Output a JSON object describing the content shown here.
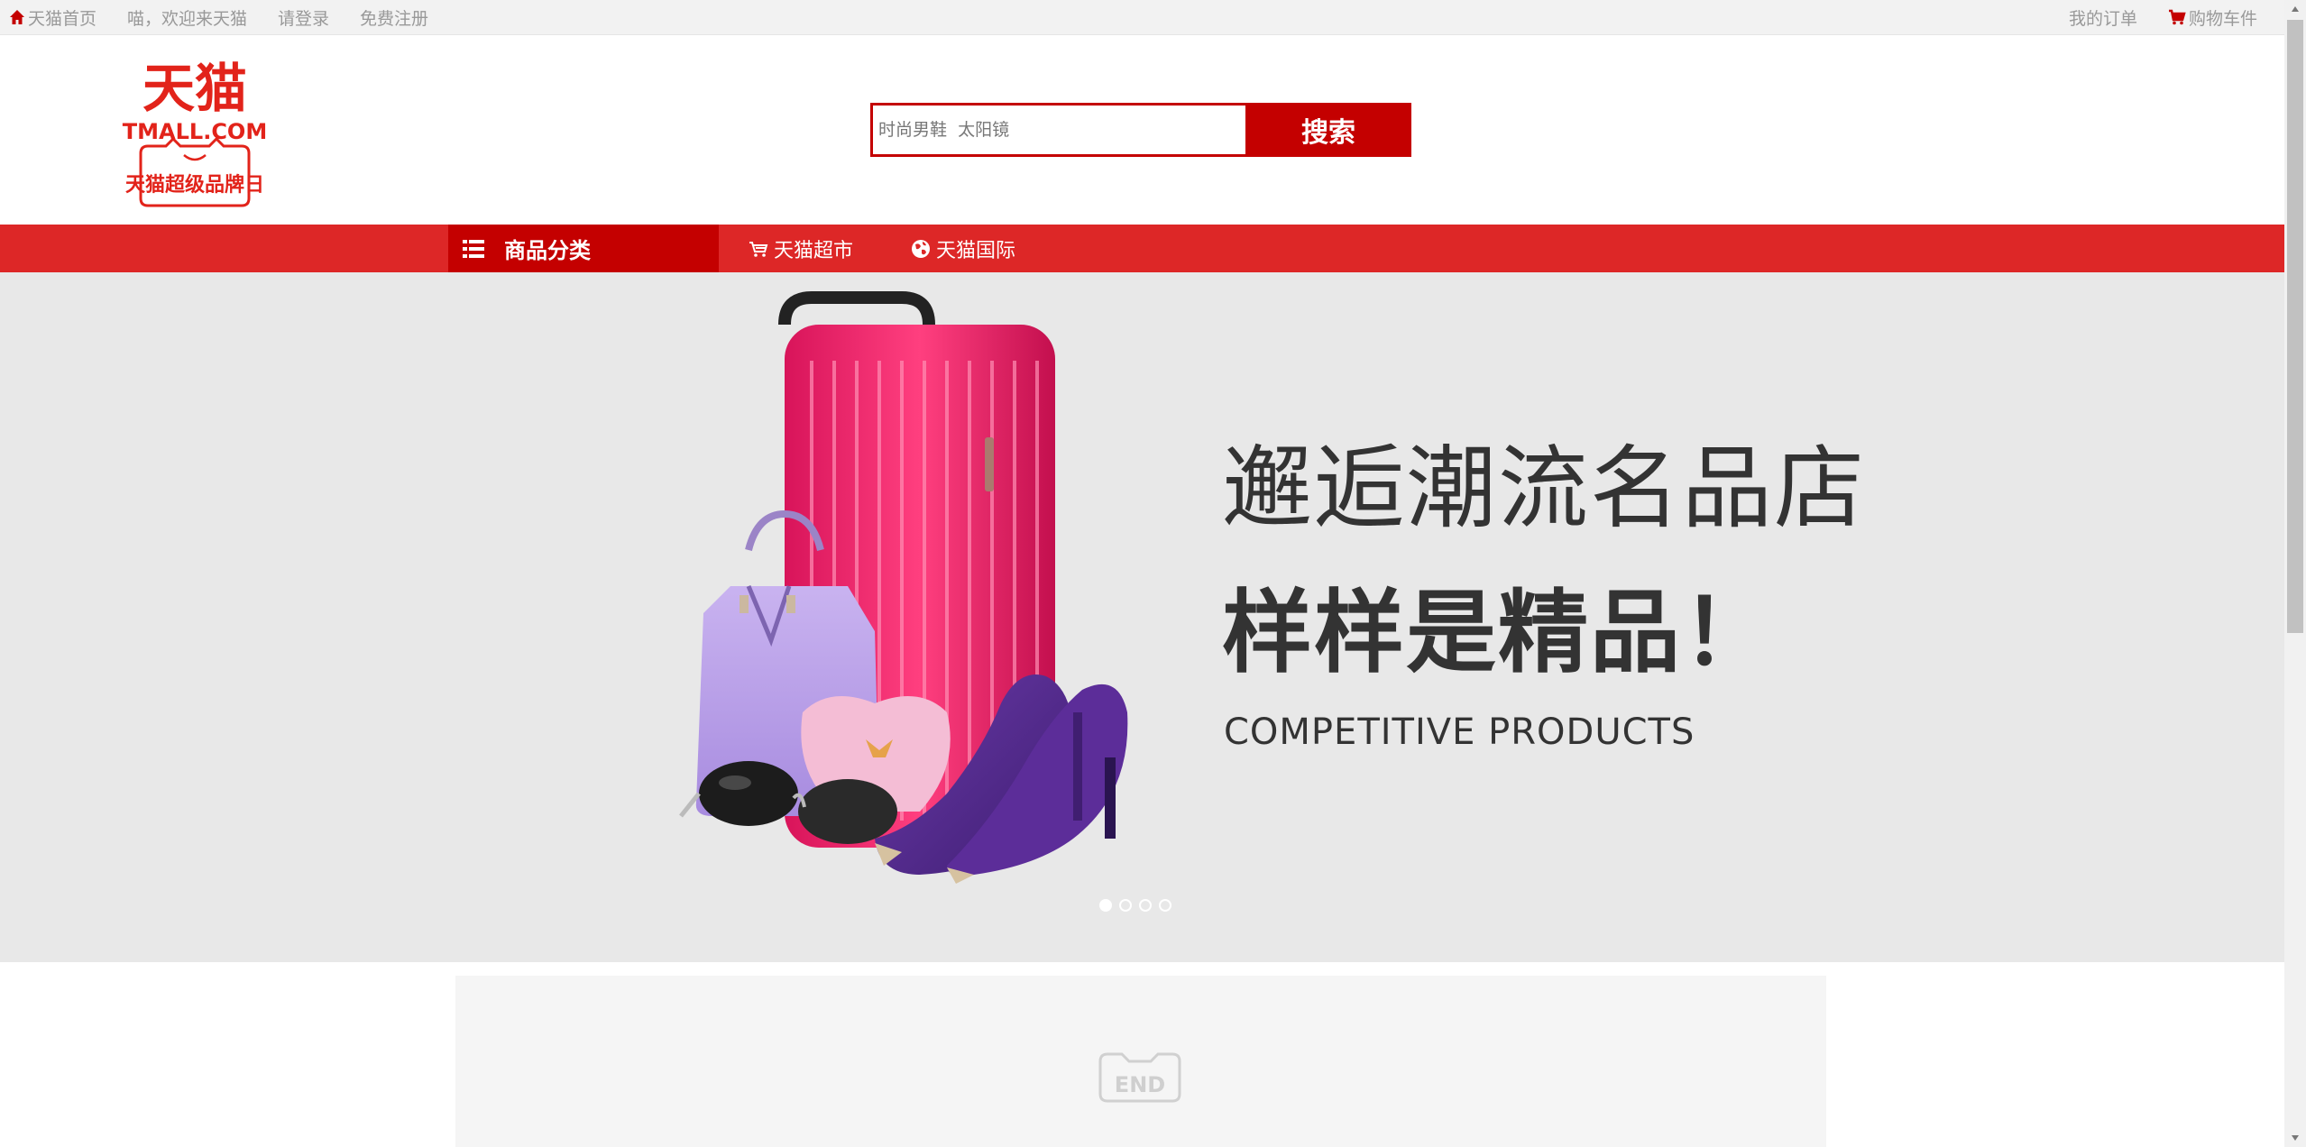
{
  "topbar": {
    "home_label": "天猫首页",
    "welcome": "喵，欢迎来天猫",
    "login": "请登录",
    "register": "免费注册",
    "orders": "我的订单",
    "cart": "购物车件"
  },
  "logo": {
    "brand_cn": "天猫",
    "brand_en": "TMALL.COM",
    "tagline": "天猫超级品牌日"
  },
  "search": {
    "placeholder": "时尚男鞋  太阳镜",
    "button": "搜索"
  },
  "nav": {
    "category_all": "商品分类",
    "supermarket": "天猫超市",
    "international": "天猫国际"
  },
  "banner": {
    "line1": "邂逅潮流名品店",
    "line2": "样样是精品！",
    "line3": "COMPETITIVE PRODUCTS",
    "slides": 4,
    "active_slide": 1
  },
  "footer_mark": "END",
  "colors": {
    "brand_red": "#c40000",
    "nav_red": "#dd2727",
    "banner_bg": "#e8e8e8"
  }
}
